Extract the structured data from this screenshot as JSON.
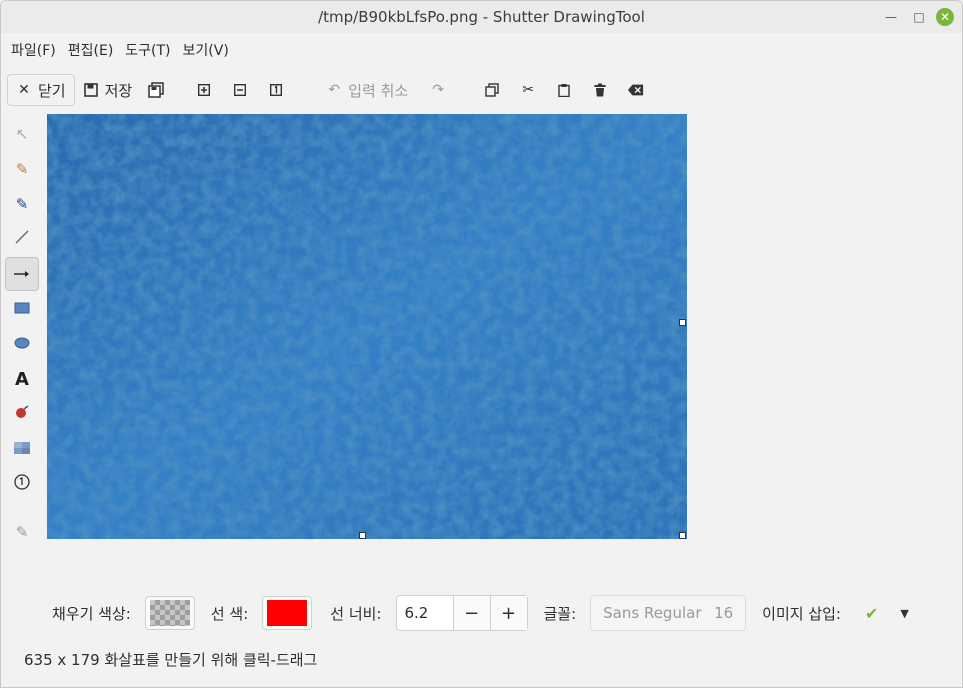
{
  "window": {
    "title": "/tmp/B90kbLfsPo.png - Shutter DrawingTool"
  },
  "menu": [
    "파일(F)",
    "편집(E)",
    "도구(T)",
    "보기(V)"
  ],
  "toolbar": {
    "close_label": "닫기",
    "save_label": "저장",
    "undo_label": "입력 취소"
  },
  "bottom": {
    "fill_color_label": "채우기 색상:",
    "line_color_label": "선 색:",
    "line_color": "#ff0000",
    "line_width_label": "선 너비:",
    "line_width_value": "6.2",
    "minus": "−",
    "plus": "+",
    "font_label": "글꼴:",
    "font_name": "Sans Regular",
    "font_size": "16",
    "insert_image_label": "이미지 삽입:"
  },
  "status": "635 x 179 화살표를 만들기 위해 클릭-드래그",
  "colors": {
    "canvas_blue": "#2a6fb2",
    "accent_green": "#7bb53c"
  }
}
